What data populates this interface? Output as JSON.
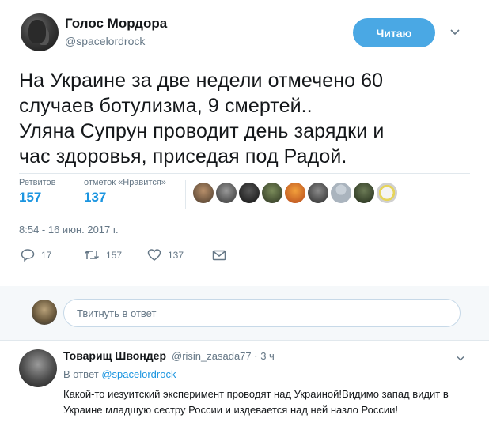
{
  "author": {
    "display_name": "Голос Мордора",
    "handle": "@spacelordrock"
  },
  "follow_button": {
    "label": "Читаю"
  },
  "tweet": {
    "text": "На Украине за две недели отмечено 60\nслучаев ботулизма, 9 смертей..\nУляна Супрун проводит день зарядки и\nчас здоровья, приседая под Радой.",
    "timestamp": "8:54 - 16 июн. 2017 г."
  },
  "stats": {
    "retweets_label": "Ретвитов",
    "retweets_value": "157",
    "likes_label": "отметок «Нравится»",
    "likes_value": "137"
  },
  "actions": {
    "replies": "17",
    "retweets": "157",
    "likes": "137"
  },
  "reply_box": {
    "placeholder": "Твитнуть в ответ"
  },
  "reply": {
    "display_name": "Товарищ Швондер",
    "handle_time": "@risin_zasada77 · 3 ч",
    "in_reply_prefix": "В ответ",
    "in_reply_handle": "@spacelordrock",
    "text": "Какой-то иезуитский эксперимент проводят над Украиной!Видимо запад видит в Украине младшую сестру России и издевается над ней назло России!"
  },
  "colors": {
    "accent": "#1b95e0",
    "button": "#4aa8e4",
    "muted": "#657786",
    "divider": "#e1e8ed"
  }
}
